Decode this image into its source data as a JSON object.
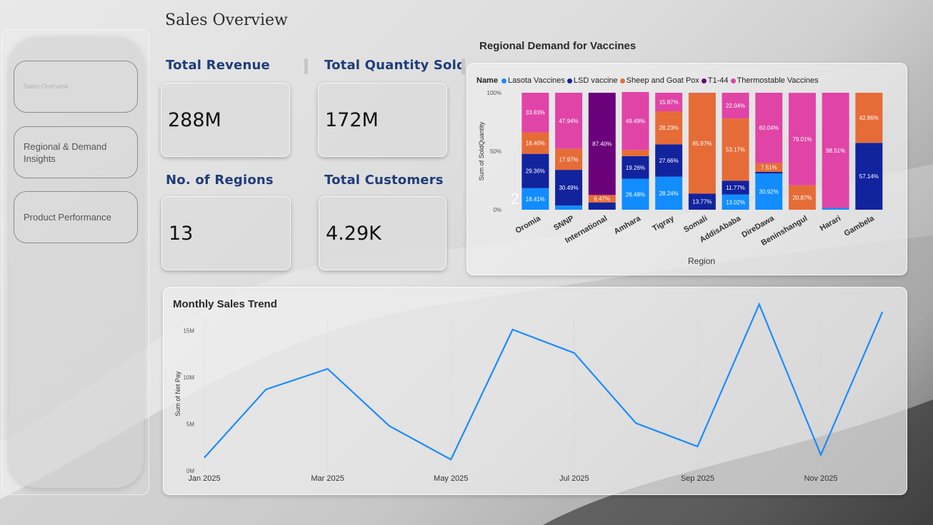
{
  "page": {
    "title": "Sales Overview"
  },
  "sidebar": {
    "items": [
      {
        "label": "Sales Overview",
        "active": true
      },
      {
        "label": "Regional & Demand Insights",
        "active": false
      },
      {
        "label": "Product Performance",
        "active": false
      }
    ]
  },
  "kpis": {
    "revenue": {
      "label": "Total Revenue",
      "value": "288M"
    },
    "quantity": {
      "label": "Total Quantity Sold",
      "value": "172M"
    },
    "regions": {
      "label": "No. of Regions",
      "value": "13"
    },
    "customers": {
      "label": "Total Customers",
      "value": "4.29K"
    }
  },
  "regional_chart": {
    "title": "Regional Demand for Vaccines",
    "legend_title": "Name",
    "stray_label": "2"
  },
  "trend_chart": {
    "title": "Monthly Sales Trend"
  },
  "colors": {
    "lasota": "#118dff",
    "lsd": "#12239e",
    "sheep_goat_pox": "#e66c37",
    "t1_44": "#6b007b",
    "thermostable": "#e044a7",
    "line": "#1a8cff",
    "kpi_label": "#1f3d7a"
  },
  "chart_data": [
    {
      "type": "bar",
      "stacked": "100%",
      "title": "Regional Demand for Vaccines",
      "xlabel": "Region",
      "ylabel": "Sum of SoldQuantity",
      "yticks": [
        "0%",
        "50%",
        "100%"
      ],
      "legend_placement": "top-left",
      "categories": [
        "Oromia",
        "SNNP",
        "International",
        "Amhara",
        "Tigray",
        "Somali",
        "AddisAbaba",
        "DireDawa",
        "Beninshangul",
        "Harari",
        "Gambela"
      ],
      "series": [
        {
          "name": "Lasota Vaccines",
          "color": "#118dff",
          "values": [
            18.41,
            3.6,
            0,
            26.48,
            28.24,
            0,
            13.02,
            30.92,
            0,
            1.49,
            0
          ]
        },
        {
          "name": "LSD vaccine",
          "color": "#12239e",
          "values": [
            29.36,
            30.49,
            6.13,
            19.26,
            27.66,
            13.77,
            11.77,
            1.53,
            0,
            0,
            57.14
          ]
        },
        {
          "name": "Sheep and Goat Pox",
          "color": "#e66c37",
          "values": [
            18.4,
            17.97,
            6.47,
            5.38,
            28.23,
            85.97,
            53.17,
            7.51,
            20.87,
            0,
            42.86
          ]
        },
        {
          "name": "T1-44",
          "color": "#6b007b",
          "values": [
            0,
            0,
            87.4,
            0,
            0,
            0,
            0,
            0,
            0,
            0,
            0
          ]
        },
        {
          "name": "Thermostable Vaccines",
          "color": "#e044a7",
          "values": [
            33.83,
            47.94,
            0,
            49.49,
            15.87,
            0.26,
            22.04,
            60.04,
            79.01,
            98.51,
            0
          ]
        }
      ],
      "data_labels": [
        [
          "18.41%",
          "",
          "",
          "26.48%",
          "28.24%",
          "",
          "13.02%",
          "30.92%",
          "",
          "",
          ""
        ],
        [
          "29.36%",
          "30.49%",
          "",
          "19.26%",
          "27.66%",
          "13.77%",
          "11.77%",
          "",
          "",
          "",
          "57.14%"
        ],
        [
          "18.40%",
          "17.97%",
          "6.47%",
          "",
          "28.23%",
          "85.97%",
          "53.17%",
          "7.51%",
          "20.87%",
          "",
          "42.86%"
        ],
        [
          "",
          "",
          "87.40%",
          "",
          "",
          "",
          "",
          "",
          "",
          "",
          ""
        ],
        [
          "33.83%",
          "47.94%",
          "",
          "49.49%",
          "15.87%",
          "",
          "22.04%",
          "60.04%",
          "79.01%",
          "98.51%",
          ""
        ]
      ]
    },
    {
      "type": "line",
      "title": "Monthly Sales Trend",
      "ylabel": "Sum of Net Pay",
      "ylim": [
        0,
        18
      ],
      "yticks": [
        0,
        5,
        10,
        15
      ],
      "ytick_labels": [
        "0M",
        "5M",
        "10M",
        "15M"
      ],
      "x": [
        "Jan 2025",
        "Feb 2025",
        "Mar 2025",
        "Apr 2025",
        "May 2025",
        "Jun 2025",
        "Jul 2025",
        "Aug 2025",
        "Sep 2025",
        "Oct 2025",
        "Nov 2025",
        "Dec 2025"
      ],
      "xtick_labels": [
        "Jan 2025",
        "Mar 2025",
        "May 2025",
        "Jul 2025",
        "Sep 2025",
        "Nov 2025"
      ],
      "series": [
        {
          "color": "#1a8cff",
          "values": [
            1.4,
            8.7,
            10.9,
            4.8,
            1.2,
            15.1,
            12.6,
            5.1,
            2.6,
            17.8,
            1.7,
            17.0
          ]
        }
      ]
    }
  ]
}
